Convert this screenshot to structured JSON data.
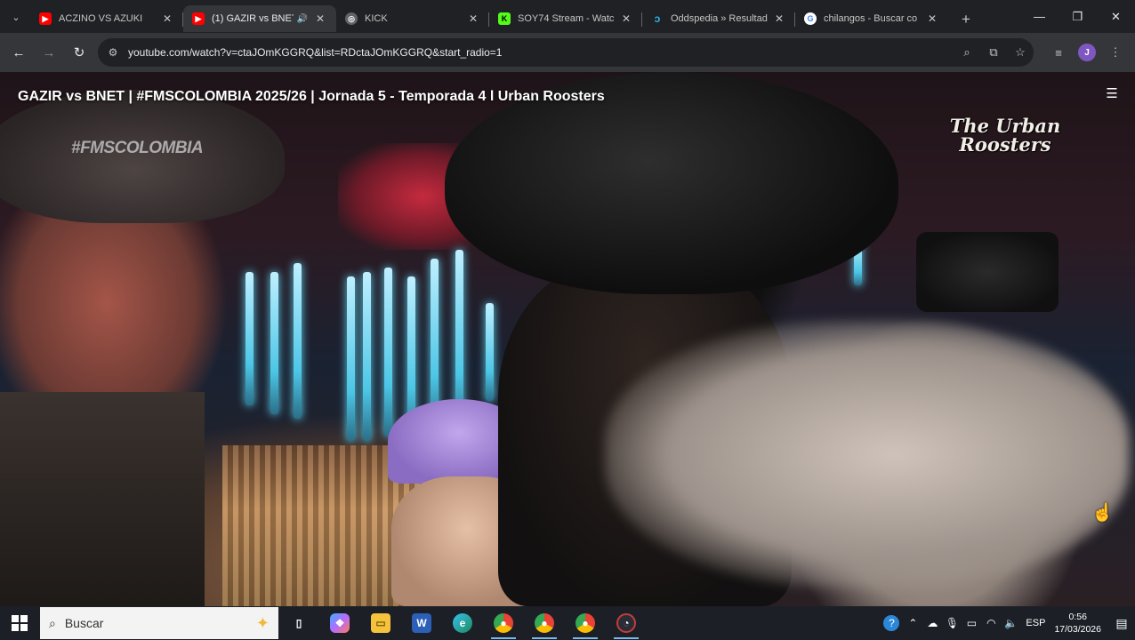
{
  "browser": {
    "tabs": [
      {
        "title": "ACZINO VS AZUKI",
        "favicon": "youtube",
        "active": false,
        "audio": false
      },
      {
        "title": "(1) GAZIR vs BNET",
        "favicon": "youtube",
        "active": true,
        "audio": true
      },
      {
        "title": "KICK",
        "favicon": "kick",
        "active": false,
        "audio": false
      },
      {
        "title": "SOY74 Stream - Watc",
        "favicon": "soy74",
        "active": false,
        "audio": false
      },
      {
        "title": "Oddspedia » Resultad",
        "favicon": "oddspedia",
        "active": false,
        "audio": false
      },
      {
        "title": "chilangos - Buscar co",
        "favicon": "google",
        "active": false,
        "audio": false
      }
    ],
    "url": "youtube.com/watch?v=ctaJOmKGGRQ&list=RDctaJOmKGGRQ&start_radio=1",
    "profile_initial": "J"
  },
  "video": {
    "title": "GAZIR vs BNET | #FMSCOLOMBIA 2025/26 | Jornada 5 - Temporada 4 l Urban Roosters",
    "watermark": "#FMSCOLOMBIA",
    "logo_lines": [
      "The Urban",
      "Roosters"
    ]
  },
  "taskbar": {
    "search_placeholder": "Buscar",
    "language": "ESP",
    "time": "0:56",
    "date": "17/03/2026"
  },
  "colors": {
    "tab_strip": "#202124",
    "toolbar": "#35363a",
    "youtube_red": "#ff0000",
    "kick_green": "#53fc18",
    "taskbar": "#1c1f26"
  }
}
